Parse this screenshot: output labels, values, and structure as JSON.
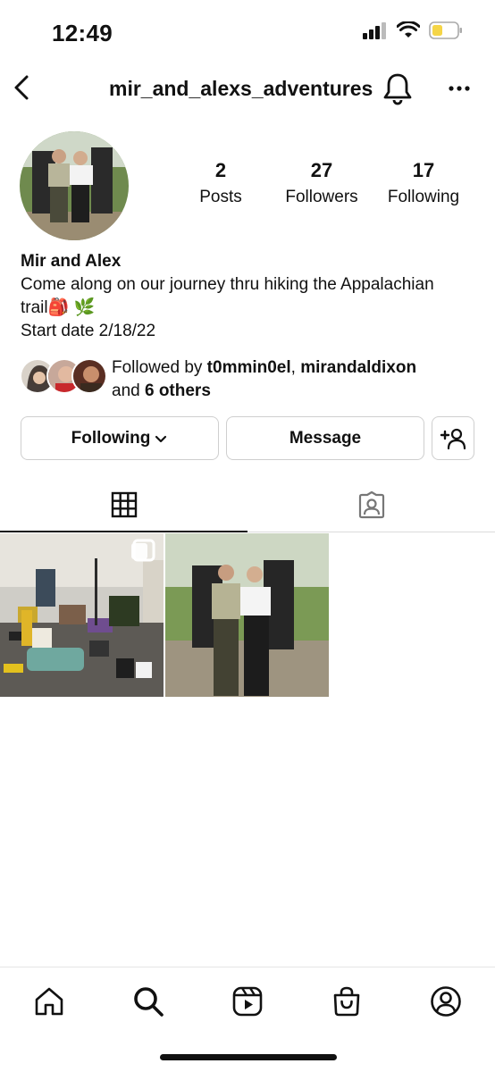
{
  "status_bar": {
    "time": "12:49",
    "icons": [
      "signal-icon",
      "wifi-icon",
      "battery-icon"
    ],
    "battery_color": "#f5d547"
  },
  "header": {
    "username": "mir_and_alexs_adventures",
    "icons": [
      "back-icon",
      "bell-icon",
      "more-icon"
    ]
  },
  "profile": {
    "stats": [
      {
        "value": "2",
        "label": "Posts"
      },
      {
        "value": "27",
        "label": "Followers"
      },
      {
        "value": "17",
        "label": "Following"
      }
    ],
    "name": "Mir and Alex",
    "bio_line1": "Come along on our journey thru hiking the Appalachian",
    "bio_line2": "trail🎒 🌿",
    "bio_line3": "Start date 2/18/22",
    "followed_by_prefix": "Followed by ",
    "followed_by_user1": "t0mmin0el",
    "followed_by_sep": ", ",
    "followed_by_user2": "mirandaldixon",
    "followed_by_and": "and ",
    "followed_by_others": "6 others"
  },
  "actions": {
    "following_label": "Following",
    "message_label": "Message"
  },
  "tabs": [
    {
      "name": "posts-grid",
      "icon": "grid-icon",
      "active": true
    },
    {
      "name": "tagged",
      "icon": "tagged-person-icon",
      "active": false
    }
  ],
  "bottom_nav": [
    "home-icon",
    "search-icon",
    "reels-icon",
    "shop-icon",
    "profile-icon"
  ],
  "colors": {
    "text": "#111111",
    "border": "#cfcfcf",
    "divider": "#dbdbdb"
  }
}
